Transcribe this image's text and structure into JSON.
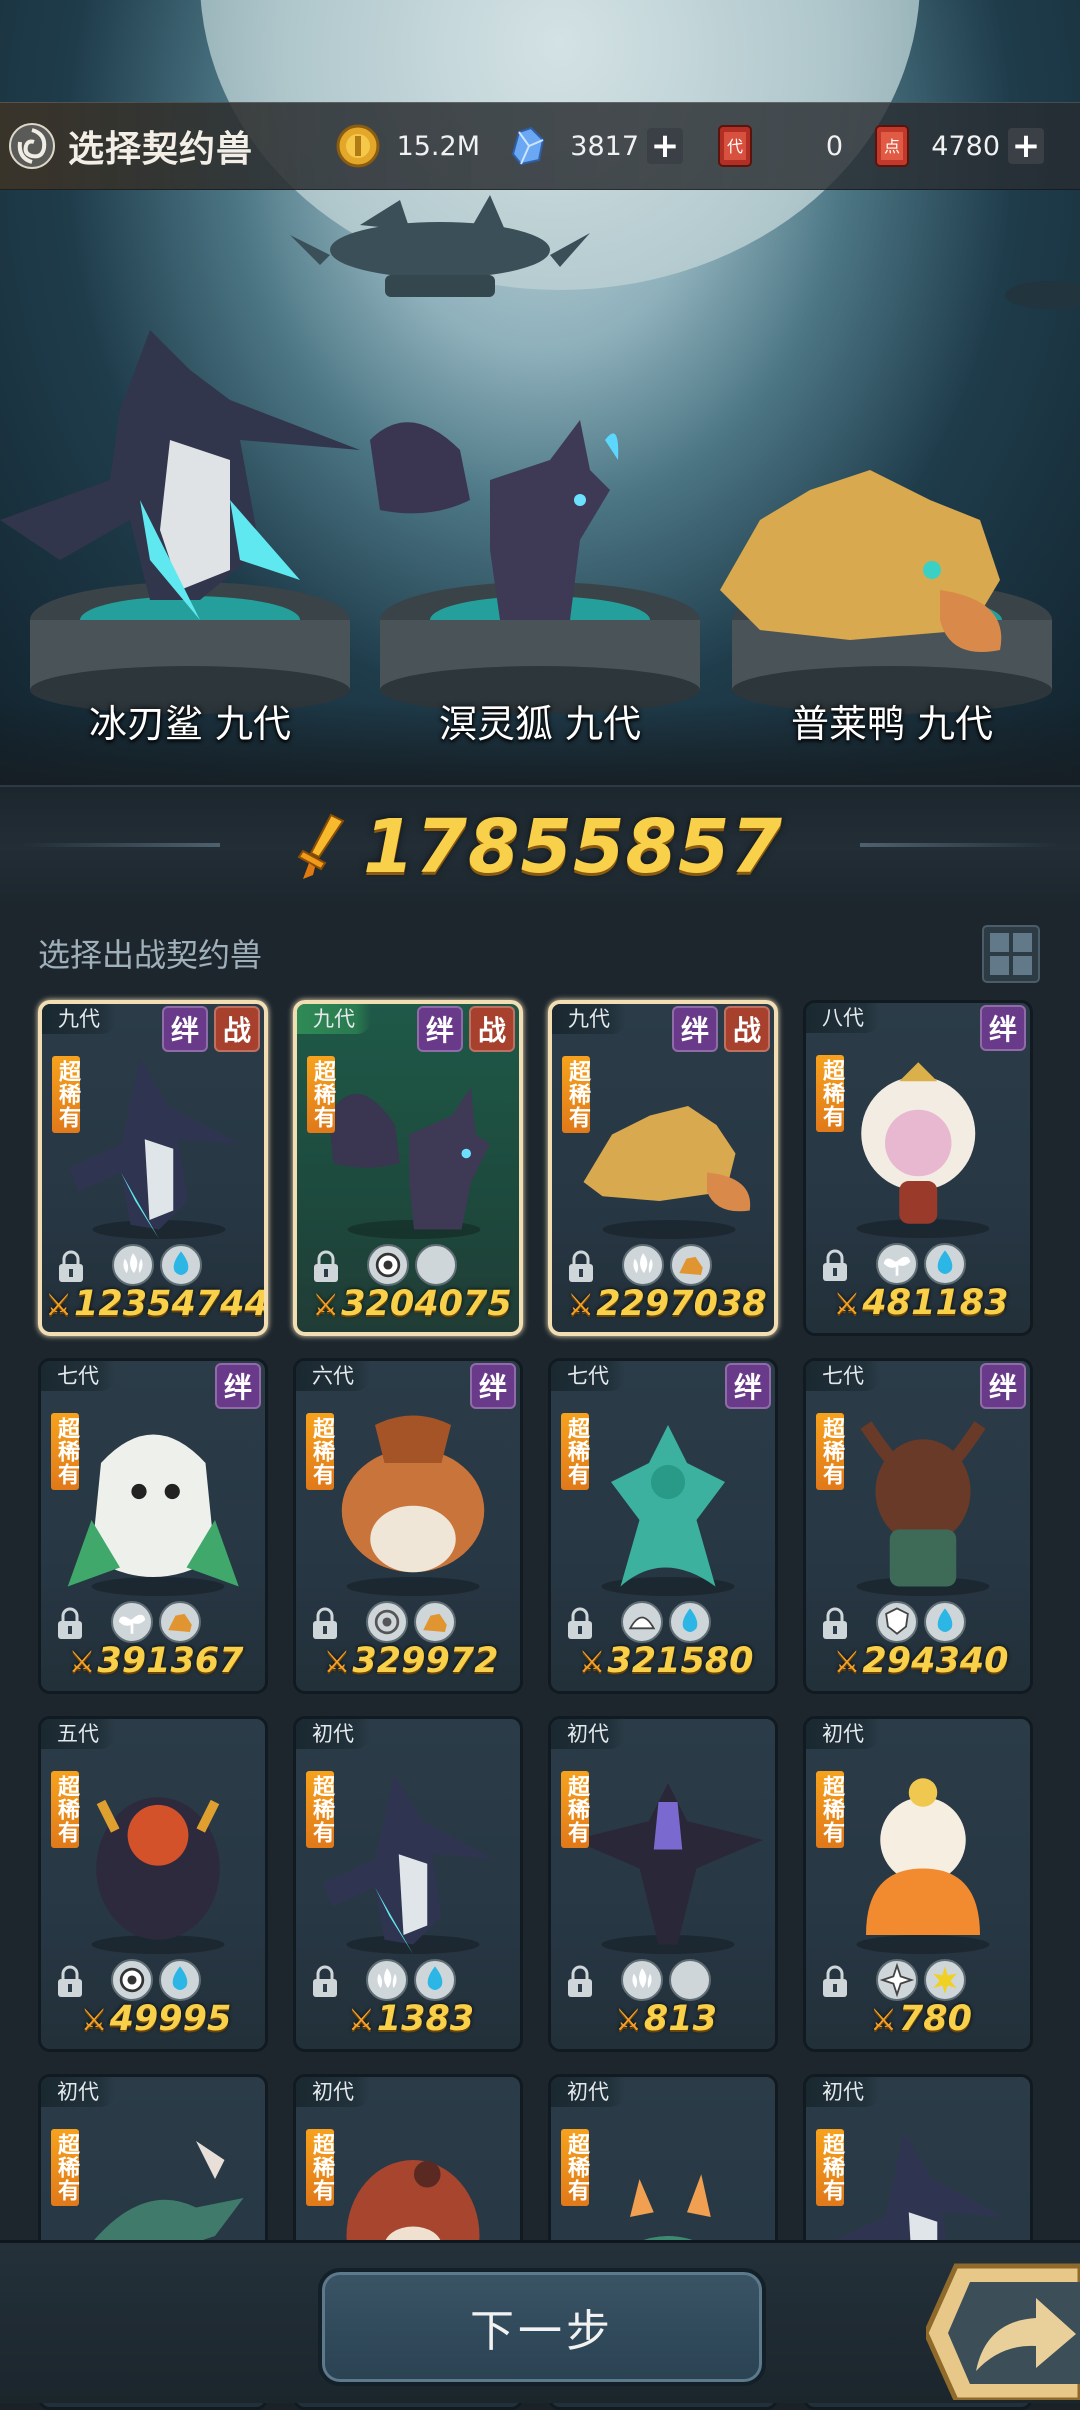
{
  "header": {
    "title": "选择契约兽",
    "resources": [
      {
        "name": "gold",
        "icon": "gold-coin-icon",
        "value": "15.2M",
        "has_plus": false
      },
      {
        "name": "crystal",
        "icon": "blue-crystal-icon",
        "value": "3817",
        "has_plus": true
      },
      {
        "name": "generation-ticket",
        "icon": "dai-ticket-icon",
        "value": "0",
        "has_plus": false
      },
      {
        "name": "point-ticket",
        "icon": "dian-ticket-icon",
        "value": "4780",
        "has_plus": true
      }
    ]
  },
  "team": [
    {
      "name": "冰刃鲨 九代",
      "icon": "ice-blade-shark-icon"
    },
    {
      "name": "溟灵狐 九代",
      "icon": "nether-fox-icon"
    },
    {
      "name": "普莱鸭 九代",
      "icon": "platypus-icon"
    }
  ],
  "total_power": "17855857",
  "section_title": "选择出战契约兽",
  "cards": [
    {
      "gen": "九代",
      "rarity": "超稀有",
      "badges": [
        "绊",
        "战"
      ],
      "power": "12354744",
      "selected": true,
      "green": false,
      "art": "ice-blade-shark-icon",
      "elements": [
        "wind",
        "water"
      ]
    },
    {
      "gen": "九代",
      "rarity": "超稀有",
      "badges": [
        "绊",
        "战"
      ],
      "power": "3204075",
      "selected": true,
      "green": true,
      "art": "nether-fox-icon",
      "elements": [
        "eye",
        "moon"
      ]
    },
    {
      "gen": "九代",
      "rarity": "超稀有",
      "badges": [
        "绊",
        "战"
      ],
      "power": "2297038",
      "selected": true,
      "green": false,
      "art": "platypus-icon",
      "elements": [
        "wind",
        "earth"
      ]
    },
    {
      "gen": "八代",
      "rarity": "超稀有",
      "badges": [
        "绊"
      ],
      "power": "481183",
      "selected": false,
      "green": false,
      "art": "pink-sheep-icon",
      "elements": [
        "plant",
        "water"
      ]
    },
    {
      "gen": "七代",
      "rarity": "超稀有",
      "badges": [
        "绊"
      ],
      "power": "391367",
      "selected": false,
      "green": false,
      "art": "white-owl-icon",
      "elements": [
        "plant",
        "earth"
      ]
    },
    {
      "gen": "六代",
      "rarity": "超稀有",
      "badges": [
        "绊"
      ],
      "power": "329972",
      "selected": false,
      "green": false,
      "art": "armadillo-icon",
      "elements": [
        "target",
        "earth"
      ]
    },
    {
      "gen": "七代",
      "rarity": "超稀有",
      "badges": [
        "绊"
      ],
      "power": "321580",
      "selected": false,
      "green": false,
      "art": "water-spirit-icon",
      "elements": [
        "shell",
        "water"
      ]
    },
    {
      "gen": "七代",
      "rarity": "超稀有",
      "badges": [
        "绊"
      ],
      "power": "294340",
      "selected": false,
      "green": false,
      "art": "horned-treant-icon",
      "elements": [
        "shield",
        "water"
      ]
    },
    {
      "gen": "五代",
      "rarity": "超稀有",
      "badges": [],
      "power": "49995",
      "selected": false,
      "green": false,
      "art": "dark-bull-icon",
      "elements": [
        "eye",
        "water"
      ]
    },
    {
      "gen": "初代",
      "rarity": "超稀有",
      "badges": [],
      "power": "1383",
      "selected": false,
      "green": false,
      "art": "ice-blade-shark-icon",
      "elements": [
        "wind",
        "water"
      ]
    },
    {
      "gen": "初代",
      "rarity": "超稀有",
      "badges": [],
      "power": "813",
      "selected": false,
      "green": false,
      "art": "dark-bird-icon",
      "elements": [
        "wind",
        "moon"
      ]
    },
    {
      "gen": "初代",
      "rarity": "超稀有",
      "badges": [],
      "power": "780",
      "selected": false,
      "green": false,
      "art": "orange-jelly-icon",
      "elements": [
        "star-compass",
        "sun"
      ]
    },
    {
      "gen": "初代",
      "rarity": "超稀有",
      "badges": [],
      "power": "",
      "selected": false,
      "green": false,
      "art": "dragon-icon",
      "elements": []
    },
    {
      "gen": "初代",
      "rarity": "超稀有",
      "badges": [],
      "power": "",
      "selected": false,
      "green": false,
      "art": "red-blob-icon",
      "elements": []
    },
    {
      "gen": "初代",
      "rarity": "超稀有",
      "badges": [],
      "power": "",
      "selected": false,
      "green": false,
      "art": "horned-lizard-icon",
      "elements": []
    },
    {
      "gen": "初代",
      "rarity": "超稀有",
      "badges": [],
      "power": "",
      "selected": false,
      "green": false,
      "art": "ice-blade-shark-icon",
      "elements": []
    }
  ],
  "footer": {
    "next_label": "下一步",
    "share_icon": "share-arrow-icon"
  }
}
